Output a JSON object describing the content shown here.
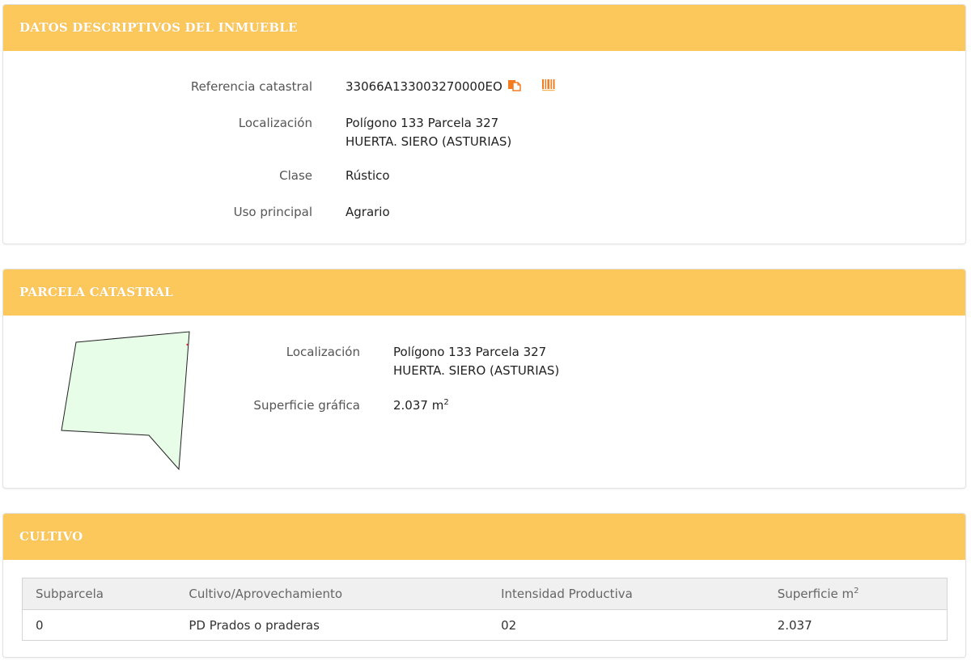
{
  "descriptivos": {
    "title": "DATOS DESCRIPTIVOS DEL INMUEBLE",
    "ref_label": "Referencia catastral",
    "ref_value": "33066A133003270000EO",
    "loc_label": "Localización",
    "loc_line1": "Polígono 133 Parcela 327",
    "loc_line2": "HUERTA. SIERO (ASTURIAS)",
    "clase_label": "Clase",
    "clase_value": "Rústico",
    "uso_label": "Uso principal",
    "uso_value": "Agrario",
    "icons": [
      "copy-icon",
      "barcode-icon"
    ],
    "icon_color": "#f47b20"
  },
  "parcela": {
    "title": "PARCELA CATASTRAL",
    "loc_label": "Localización",
    "loc_line1": "Polígono 133 Parcela 327",
    "loc_line2": "HUERTA. SIERO (ASTURIAS)",
    "sup_label": "Superficie gráfica",
    "sup_value": "2.037 m",
    "sup_exp": "2",
    "shape_fill": "#e8fde8"
  },
  "cultivo": {
    "title": "CULTIVO",
    "columns": [
      "Subparcela",
      "Cultivo/Aprovechamiento",
      "Intensidad Productiva",
      "Superficie m"
    ],
    "last_col_exp": "2",
    "rows": [
      [
        "0",
        "PD Prados o praderas",
        "02",
        "2.037"
      ]
    ]
  },
  "colors": {
    "header_bg": "#fcc85c",
    "header_text": "#ffffff"
  }
}
